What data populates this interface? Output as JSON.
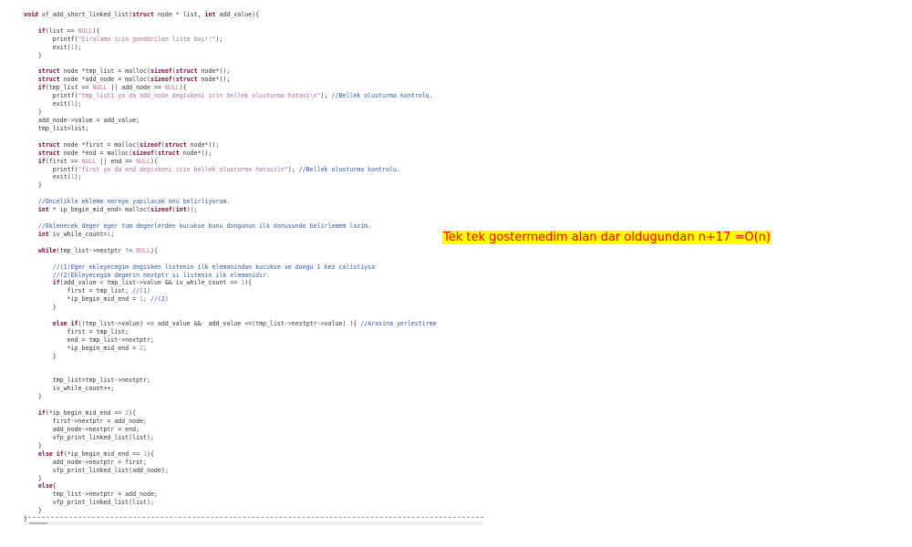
{
  "editor": {
    "lines": [
      "void vf_add_short_linked_list(struct node * list, int add_value){",
      "",
      "    if(list == NULL){",
      "        printf(\"Siralama icin gonderilen liste bos!!\");",
      "        exit(1);",
      "    }",
      "",
      "    struct node *tmp_list = malloc(sizeof(struct node*));",
      "    struct node *add_node = malloc(sizeof(struct node*));",
      "    if(tmp_list == NULL || add_node == NULL){",
      "        printf(\"tmp_list1 ya da add_node degiskeni icin bellek olusturma hatasi\\n\"); //Bellek olusturma kontrolu.",
      "        exit(1);",
      "    }",
      "    add_node->value = add_value;",
      "    tmp_list=list;",
      "",
      "    struct node *first = malloc(sizeof(struct node*));",
      "    struct node *end = malloc(sizeof(struct node*));",
      "    if(first == NULL || end == NULL){",
      "        printf(\"first ya da end degiskeni icin bellek olusturma hatasi\\n\"); //Bellek olusturma kontrolu.",
      "        exit(1);",
      "    }",
      "",
      "    //Oncelikle ekleme nereye yapilacak onu belirliyorum.",
      "    int * ip_begin_mid_end= malloc(sizeof(int));",
      "",
      "    //Eklenecek deger eger tum degerlerden kucukse bunu dongunun ilk donusunde belirlemem lazim.",
      "    int iv_while_count=1;",
      "",
      "    while(tmp_list->nextptr != NULL){",
      "",
      "        //(1)Eger ekleyecegim degisken listenin ilk elemanindan kucukse ve dongu 1 kez calistiysa",
      "        //(2)Ekleyecegim degerin nextptr si listenin ilk elemanidir.",
      "        if(add_value < tmp_list->value && iv_while_count == 1){",
      "            first = tmp_list; //(1)",
      "            *ip_begin_mid_end = 1; //(2)",
      "        }",
      "",
      "        else if((tmp_list->value) <= add_value &&  add_value <=(tmp_list->nextptr->value) ){ //Arasina yerlestirme",
      "            first = tmp_list;",
      "            end = tmp_list->nextptr;",
      "            *ip_begin_mid_end = 2;",
      "        }",
      "",
      "",
      "        tmp_list=tmp_list->nextptr;",
      "        iv_while_count++;",
      "    }",
      "",
      "    if(*ip_begin_mid_end == 2){",
      "        first->nextptr = add_node;",
      "        add_node->nextptr = end;",
      "        vfp_print_linked_list(list);",
      "    }",
      "    else if(*ip_begin_mid_end == 1){",
      "        add_node->nextptr = first;",
      "        vfp_print_linked_list(add_node);",
      "    }",
      "    else{",
      "        tmp_list->nextptr = add_node;",
      "        vfp_print_linked_list(list);",
      "    }",
      "}"
    ]
  },
  "annotation": {
    "text": "Tek tek gostermedim alan dar oldugundan n+17 =O(n)"
  }
}
